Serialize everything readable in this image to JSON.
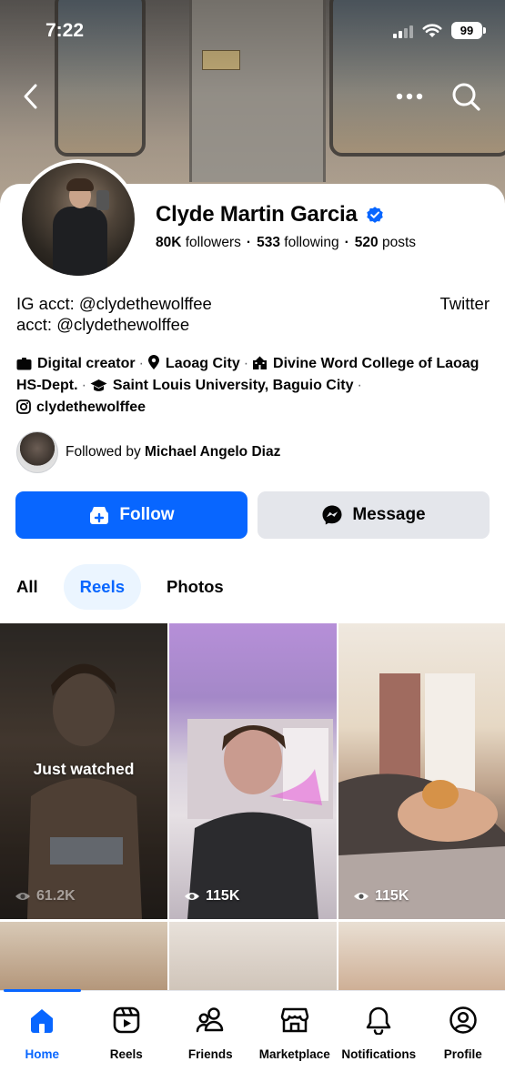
{
  "status_bar": {
    "time": "7:22",
    "battery": "99"
  },
  "profile": {
    "name": "Clyde Martin Garcia",
    "verified": true,
    "stats": {
      "followers_count": "80K",
      "followers_label": "followers",
      "following_count": "533",
      "following_label": "following",
      "posts_count": "520",
      "posts_label": "posts"
    },
    "bio": {
      "line1": "IG acct: @clydethewolffee",
      "line2": "acct: @clydethewolffee",
      "twitter": "Twitter"
    },
    "details": {
      "category": "Digital creator",
      "location": "Laoag City",
      "school1": "Divine Word College of Laoag HS-Dept.",
      "school2": "Saint Louis University, Baguio City",
      "instagram": "clydethewolffee"
    },
    "followed_by": {
      "prefix": "Followed by",
      "name": "Michael Angelo Diaz"
    }
  },
  "actions": {
    "follow": "Follow",
    "message": "Message"
  },
  "tabs": [
    {
      "label": "All",
      "active": false
    },
    {
      "label": "Reels",
      "active": true
    },
    {
      "label": "Photos",
      "active": false
    }
  ],
  "reels": [
    {
      "views": "61.2K",
      "overlay": "Just watched"
    },
    {
      "views": "115K"
    },
    {
      "views": "115K"
    }
  ],
  "bottom_nav": [
    {
      "label": "Home",
      "icon": "home-icon",
      "active": true
    },
    {
      "label": "Reels",
      "icon": "reels-icon",
      "active": false
    },
    {
      "label": "Friends",
      "icon": "friends-icon",
      "active": false
    },
    {
      "label": "Marketplace",
      "icon": "marketplace-icon",
      "active": false
    },
    {
      "label": "Notifications",
      "icon": "bell-icon",
      "active": false
    },
    {
      "label": "Profile",
      "icon": "profile-icon",
      "active": false
    }
  ],
  "colors": {
    "accent": "#0866ff",
    "verified": "#0866ff",
    "secondary_button": "#e4e6eb",
    "active_tab_bg": "#ebf5ff"
  }
}
